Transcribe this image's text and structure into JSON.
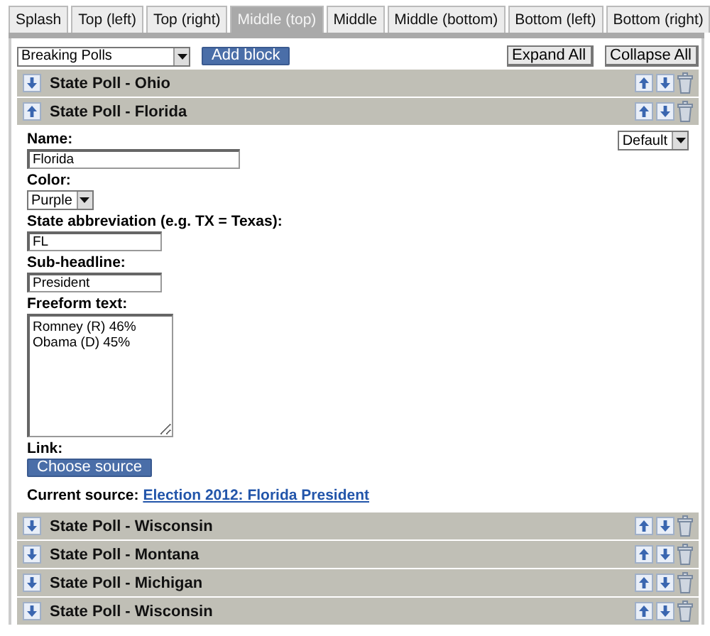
{
  "tabs": [
    {
      "label": "Splash",
      "selected": false
    },
    {
      "label": "Top (left)",
      "selected": false
    },
    {
      "label": "Top (right)",
      "selected": false
    },
    {
      "label": "Middle (top)",
      "selected": true
    },
    {
      "label": "Middle",
      "selected": false
    },
    {
      "label": "Middle (bottom)",
      "selected": false
    },
    {
      "label": "Bottom (left)",
      "selected": false
    },
    {
      "label": "Bottom (right)",
      "selected": false
    }
  ],
  "toolbar": {
    "block_type": "Breaking Polls",
    "add_button": "Add block",
    "expand_all": "Expand All",
    "collapse_all": "Collapse All"
  },
  "blocks": [
    {
      "title": "State Poll - Ohio",
      "expanded": false
    },
    {
      "title": "State Poll - Florida",
      "expanded": true,
      "style": "Default",
      "fields": [
        {
          "kind": "wide_text",
          "label": "Name:",
          "value": "Florida"
        },
        {
          "kind": "select",
          "label": "Color:",
          "value": "Purple"
        },
        {
          "kind": "text",
          "label": "State abbreviation (e.g. TX = Texas):",
          "value": "FL"
        },
        {
          "kind": "text",
          "label": "Sub-headline:",
          "value": "President"
        },
        {
          "kind": "textarea",
          "label": "Freeform text:",
          "value": "Romney (R) 46%\nObama (D) 45%"
        },
        {
          "kind": "link",
          "label": "Link:",
          "button": "Choose source",
          "source_label": "Current source:",
          "source": "Election 2012: Florida President"
        }
      ]
    },
    {
      "title": "State Poll - Wisconsin",
      "expanded": false
    },
    {
      "title": "State Poll - Montana",
      "expanded": false
    },
    {
      "title": "State Poll - Michigan",
      "expanded": false
    },
    {
      "title": "State Poll - Wisconsin",
      "expanded": false
    }
  ]
}
